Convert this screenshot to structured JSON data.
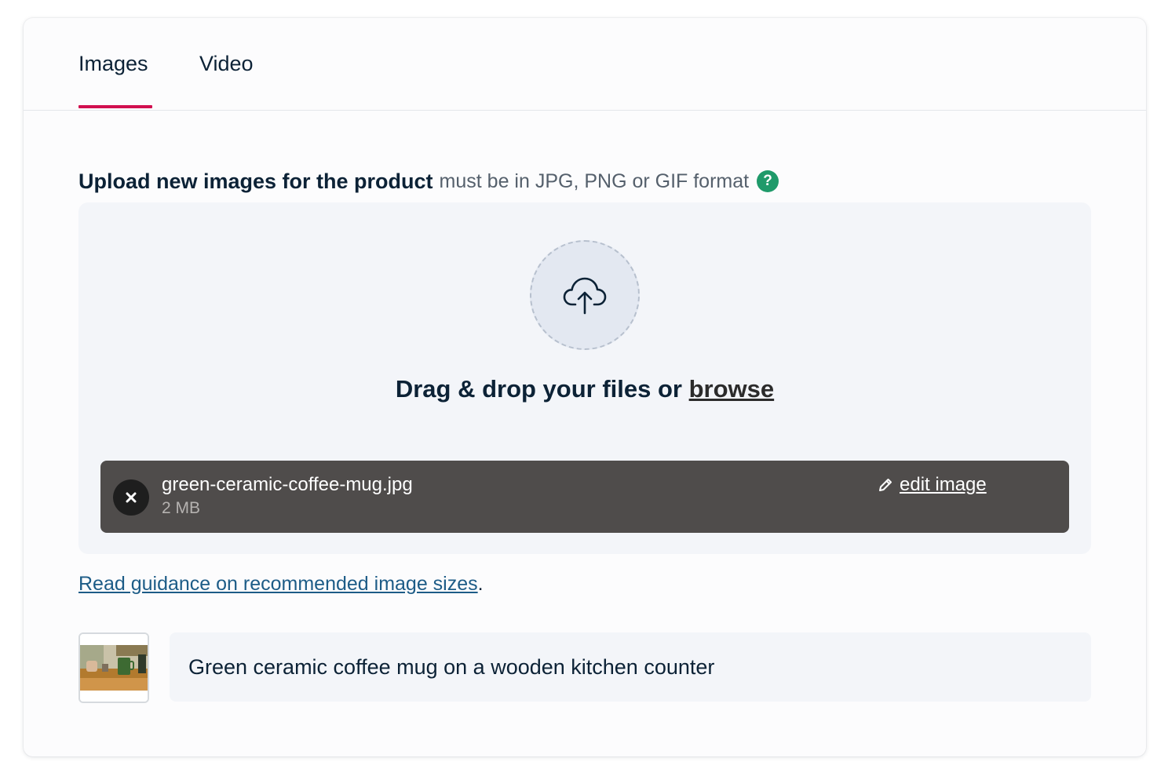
{
  "tabs": [
    {
      "label": "Images",
      "active": true
    },
    {
      "label": "Video",
      "active": false
    }
  ],
  "upload": {
    "heading": "Upload new images for the product",
    "format_note": "must be in JPG, PNG or GIF format",
    "help_icon_glyph": "?",
    "icon": "cloud-upload-icon",
    "drop_text": "Drag & drop your files or",
    "browse_label": "browse"
  },
  "file": {
    "name": "green-ceramic-coffee-mug.jpg",
    "size": "2 MB",
    "edit_label": "edit image",
    "remove_icon": "close-icon",
    "edit_icon": "pencil-icon"
  },
  "guidance": {
    "link_text": "Read guidance on recommended image sizes",
    "trailing": "."
  },
  "alt_text": {
    "value": "Green ceramic coffee mug on a wooden kitchen counter"
  },
  "colors": {
    "accent": "#d10f4f",
    "help": "#1f9a6a",
    "link": "#1d5c87",
    "file_row": "#4f4c4b"
  }
}
